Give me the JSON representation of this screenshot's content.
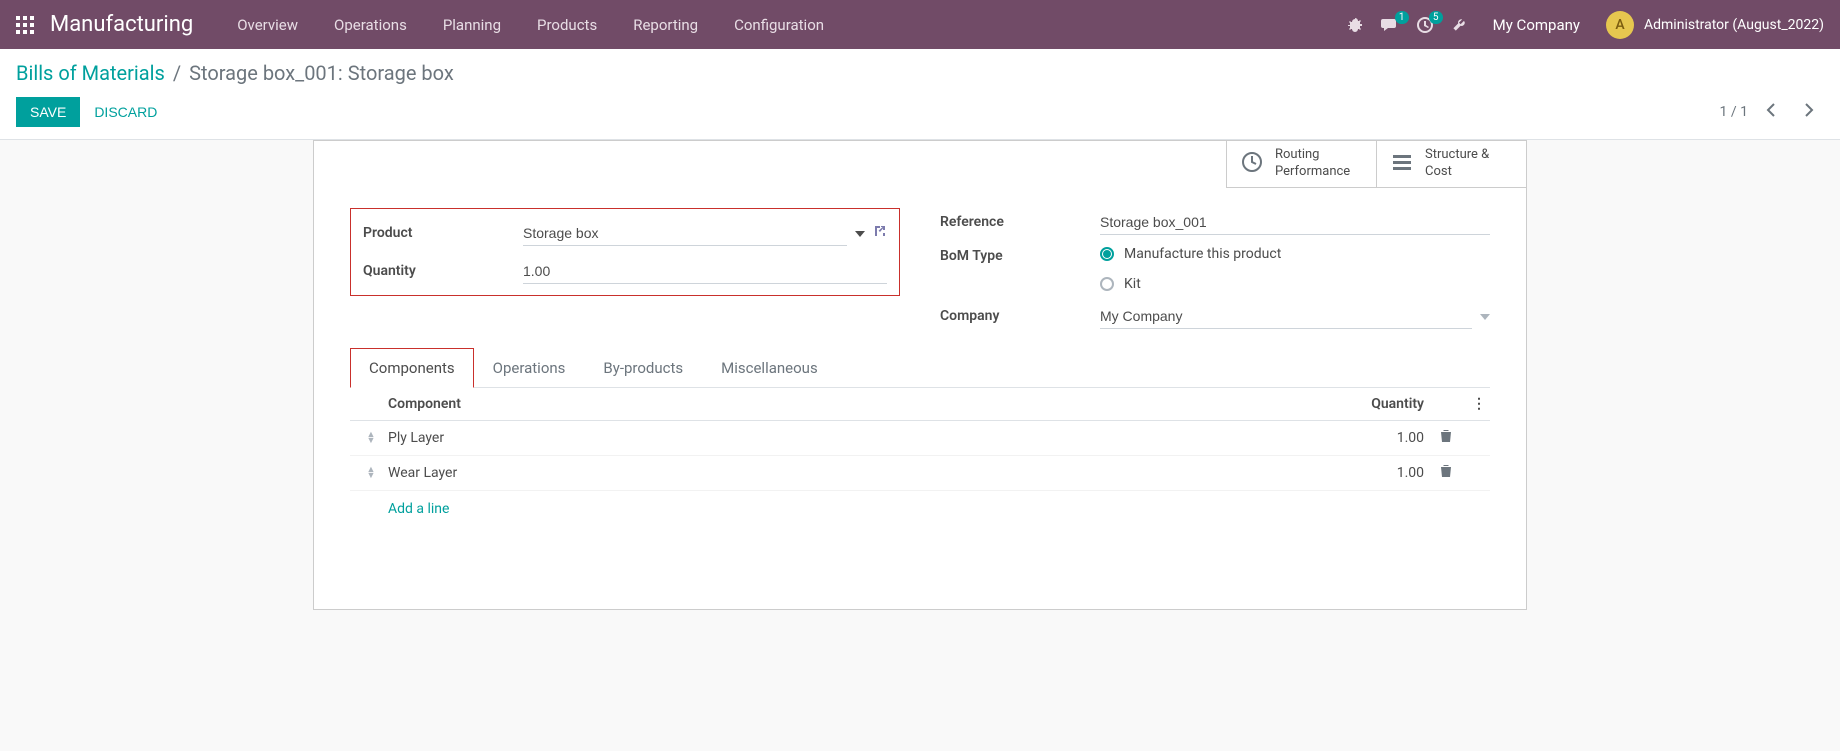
{
  "navbar": {
    "app_title": "Manufacturing",
    "menu": [
      "Overview",
      "Operations",
      "Planning",
      "Products",
      "Reporting",
      "Configuration"
    ],
    "messaging_badge": "1",
    "activity_badge": "5",
    "company": "My Company",
    "avatar_letter": "A",
    "username": "Administrator (August_2022)"
  },
  "breadcrumb": {
    "root": "Bills of Materials",
    "sep": "/",
    "current": "Storage box_001: Storage box"
  },
  "buttons": {
    "save": "SAVE",
    "discard": "DISCARD"
  },
  "pager": {
    "text": "1 / 1"
  },
  "stat_buttons": {
    "routing_l1": "Routing",
    "routing_l2": "Performance",
    "structure_l1": "Structure &",
    "structure_l2": "Cost"
  },
  "form": {
    "product_label": "Product",
    "product_value": "Storage box",
    "quantity_label": "Quantity",
    "quantity_value": "1.00",
    "reference_label": "Reference",
    "reference_value": "Storage box_001",
    "bom_type_label": "BoM Type",
    "bom_type_opts": {
      "manufacture": "Manufacture this product",
      "kit": "Kit"
    },
    "company_label": "Company",
    "company_value": "My Company"
  },
  "tabs": [
    "Components",
    "Operations",
    "By-products",
    "Miscellaneous"
  ],
  "grid": {
    "headers": {
      "component": "Component",
      "quantity": "Quantity"
    },
    "rows": [
      {
        "component": "Ply Layer",
        "quantity": "1.00"
      },
      {
        "component": "Wear Layer",
        "quantity": "1.00"
      }
    ],
    "add_line": "Add a line"
  }
}
